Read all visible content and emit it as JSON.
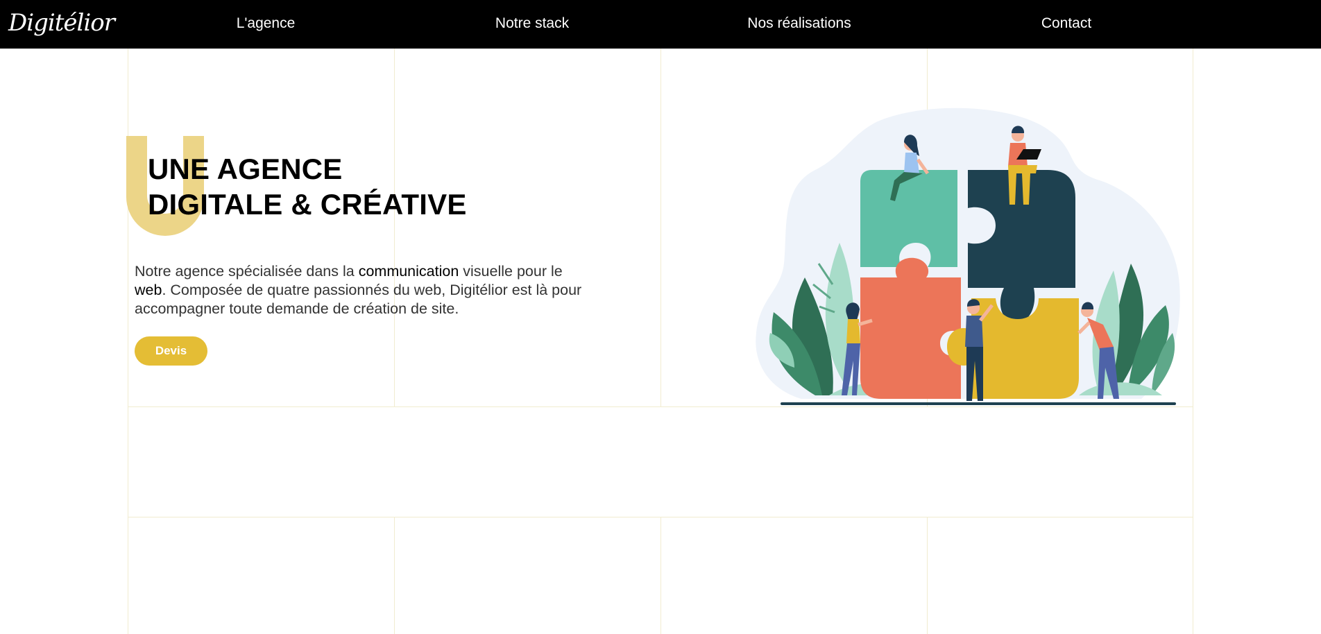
{
  "nav": {
    "logo": "Digitélior",
    "links": [
      "L'agence",
      "Notre stack",
      "Nos réalisations",
      "Contact"
    ]
  },
  "hero": {
    "big_letter": "U",
    "title_line1": "UNE AGENCE",
    "title_line2": "DIGITALE & CRÉATIVE",
    "text_part1": "Notre agence spécialisée dans la ",
    "text_strong1": "communication",
    "text_part2": " visuelle pour le ",
    "text_strong2": "web",
    "text_part3": ". Composée de quatre passionnés du web, Digitélior est là pour accompagner toute demande de création de site.",
    "cta_label": "Devis"
  },
  "illustration": {
    "icon": "team-puzzle-illustration",
    "colors": {
      "teal": "#5fbfa6",
      "dark_teal": "#1e4150",
      "coral": "#ec7559",
      "yellow": "#e4b92e",
      "leaf_dark": "#2f6f55",
      "leaf_light": "#a8dcc9",
      "blob": "#eef3fa"
    }
  },
  "colors": {
    "nav_bg": "#000000",
    "accent_yellow": "#e4bd35",
    "accent_pale": "#ecd588",
    "grid_line": "#f1ecd0"
  }
}
